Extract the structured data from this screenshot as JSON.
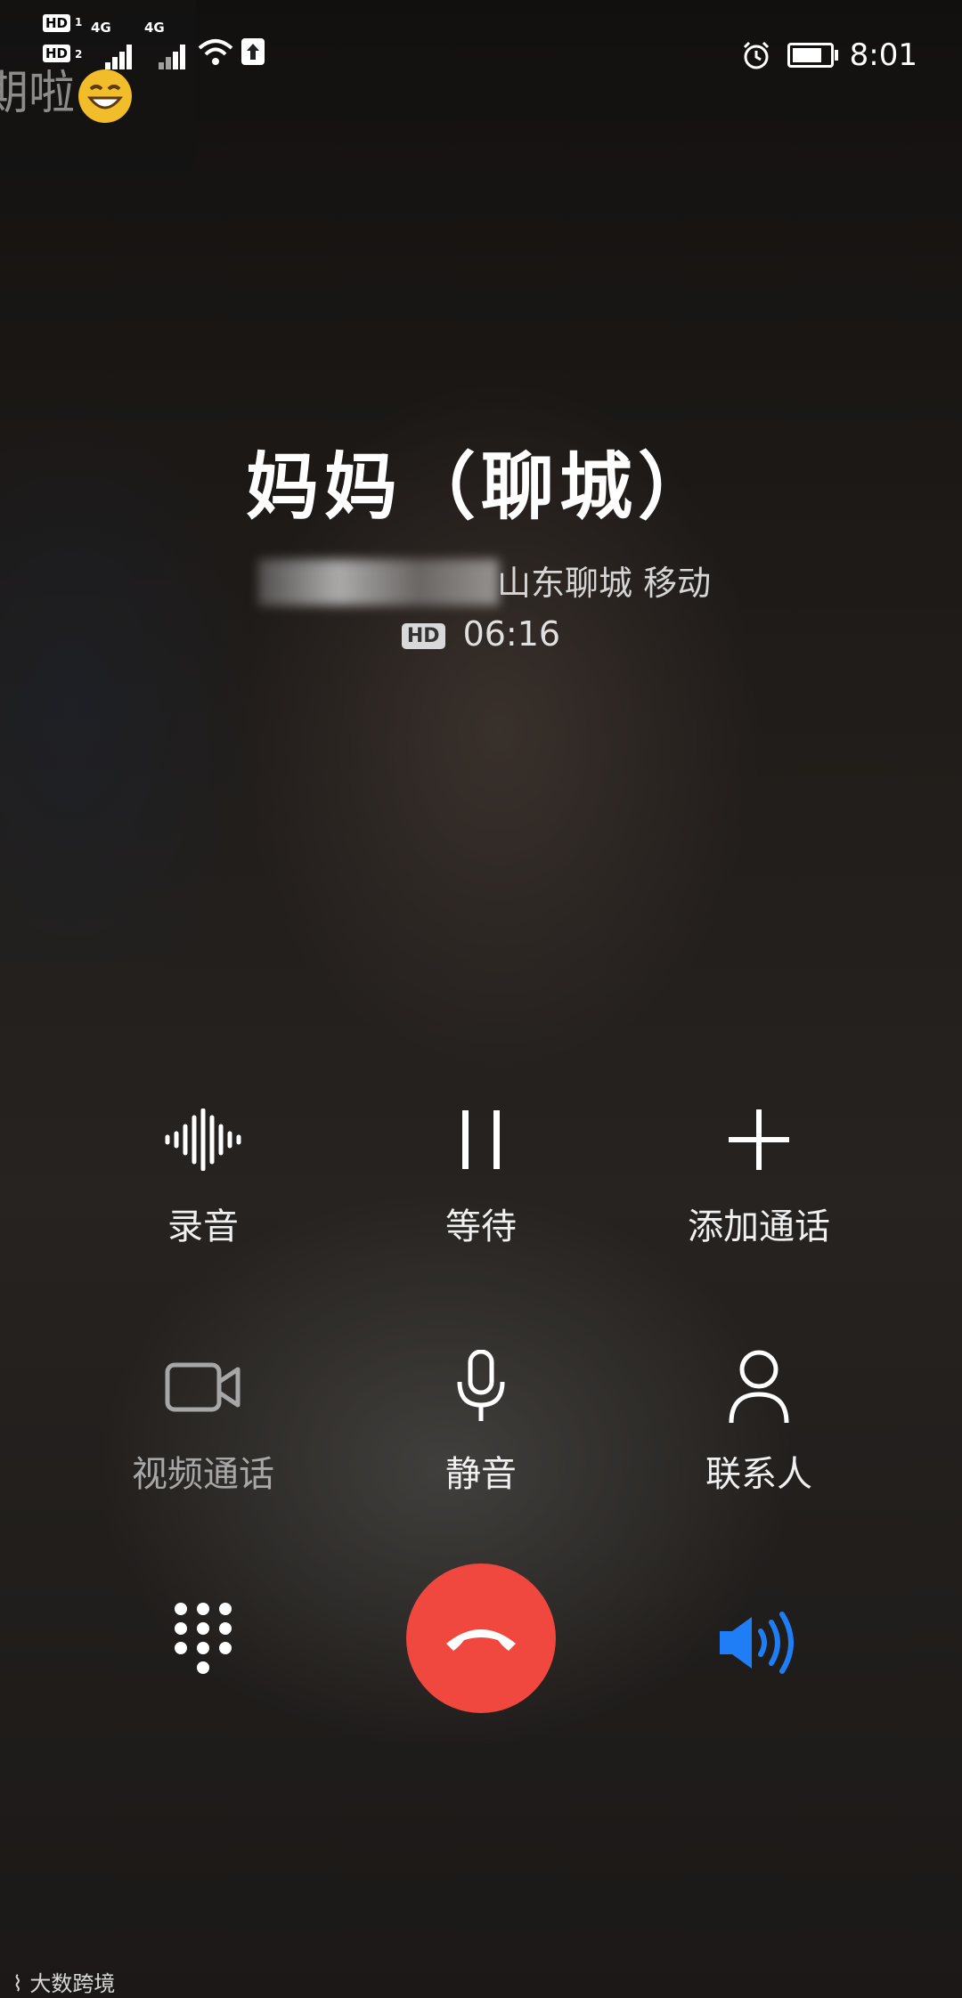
{
  "notification": {
    "text": "期啦",
    "emoji": "smiling-face-emoji"
  },
  "status_bar": {
    "sim1_hd": "HD",
    "sim1_index": "1",
    "sim1_network": "4G",
    "sim2_hd": "HD",
    "sim2_index": "2",
    "sim2_network": "4G",
    "time": "8:01"
  },
  "call": {
    "caller_name": "妈妈（聊城）",
    "location_carrier": "山东聊城 移动",
    "hd_badge": "HD",
    "duration": "06:16"
  },
  "actions_row1": [
    {
      "label": "录音",
      "icon": "record-waveform-icon"
    },
    {
      "label": "等待",
      "icon": "pause-icon"
    },
    {
      "label": "添加通话",
      "icon": "plus-icon"
    }
  ],
  "actions_row2": [
    {
      "label": "视频通话",
      "icon": "video-camera-icon",
      "disabled": true
    },
    {
      "label": "静音",
      "icon": "microphone-icon"
    },
    {
      "label": "联系人",
      "icon": "person-icon"
    }
  ],
  "bottom_bar": {
    "dialpad_icon": "dialpad-icon",
    "end_call_color": "#f0483e",
    "speaker_icon": "speaker-icon",
    "speaker_active_color": "#1f7ef5"
  },
  "watermark": "大数跨境"
}
